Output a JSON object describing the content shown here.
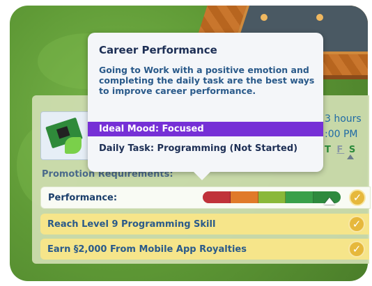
{
  "tooltip": {
    "title": "Career Performance",
    "body": "Going to Work with a positive emotion and completing the daily task are the best ways to improve career performance.",
    "ideal_mood": "Ideal Mood: Focused",
    "daily_task": "Daily Task: Programming (Not Started)"
  },
  "work_info": {
    "hours": "3 hours",
    "start_time": ":00 PM",
    "days": [
      "T",
      "F",
      "S"
    ]
  },
  "promotion": {
    "label": "Promotion Requirements:",
    "performance_label": "Performance:",
    "performance_level": 0.92,
    "performance_colors": [
      "#c0323a",
      "#e07a2a",
      "#8ab83a",
      "#3aa04a",
      "#2e8a3e"
    ],
    "goals": [
      {
        "label": "Reach Level 9 Programming Skill",
        "complete": true
      },
      {
        "label": "Earn §2,000 From Mobile App Royalties",
        "complete": true
      }
    ],
    "check_glyph": "✓"
  }
}
